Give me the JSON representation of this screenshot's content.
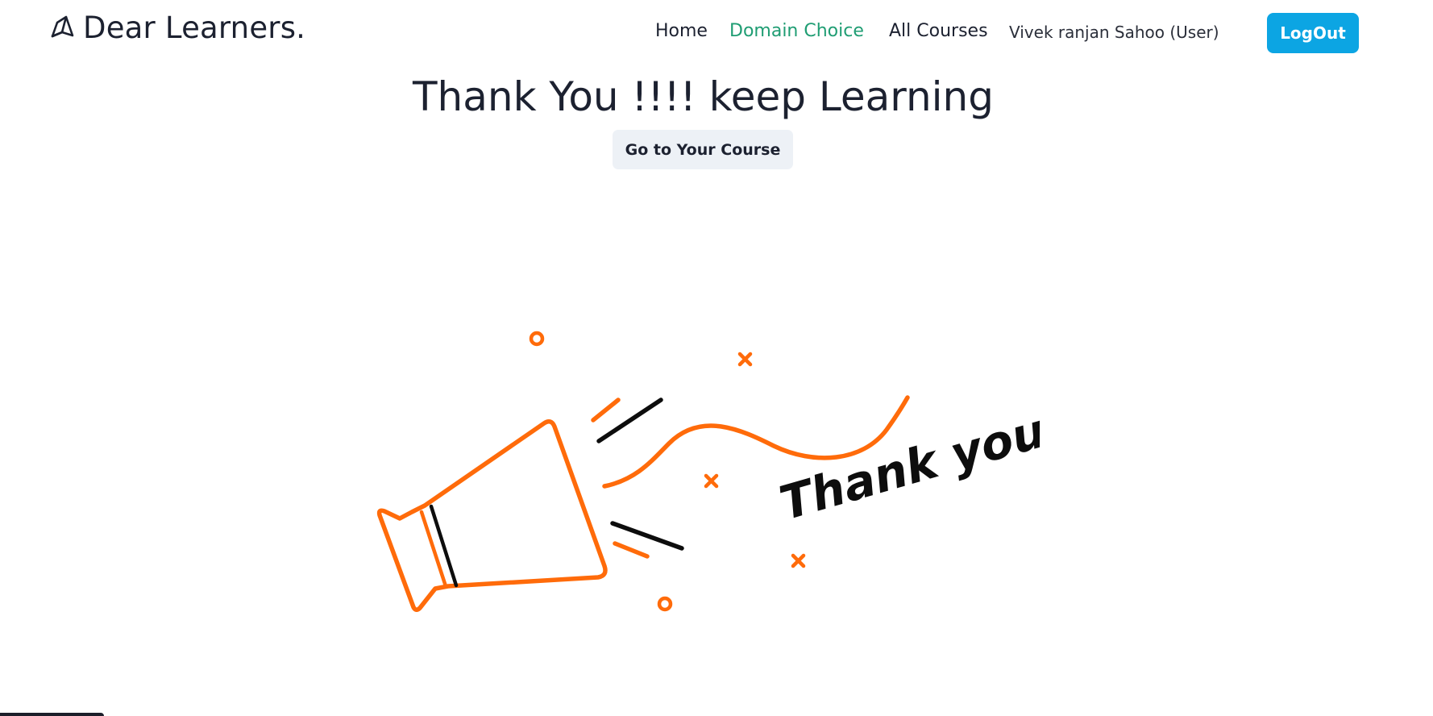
{
  "brand": {
    "icon": "book-icon",
    "name": "Dear Learners."
  },
  "nav": {
    "home": "Home",
    "domain_choice": "Domain Choice",
    "all_courses": "All Courses",
    "user": "Vivek ranjan Sahoo (User)",
    "logout": "LogOut"
  },
  "main": {
    "heading": "Thank You !!!! keep Learning",
    "course_button": "Go to Your Course"
  },
  "illustration": {
    "icon": "megaphone-icon",
    "caption": "Thank you!"
  },
  "colors": {
    "brand_text": "#1c2130",
    "nav_active": "#1f9d73",
    "logout_bg": "#0ca5e3",
    "course_btn_bg": "#edf1f6",
    "illustration_accent": "#ff6b0a",
    "illustration_ink": "#0d0d0d"
  }
}
